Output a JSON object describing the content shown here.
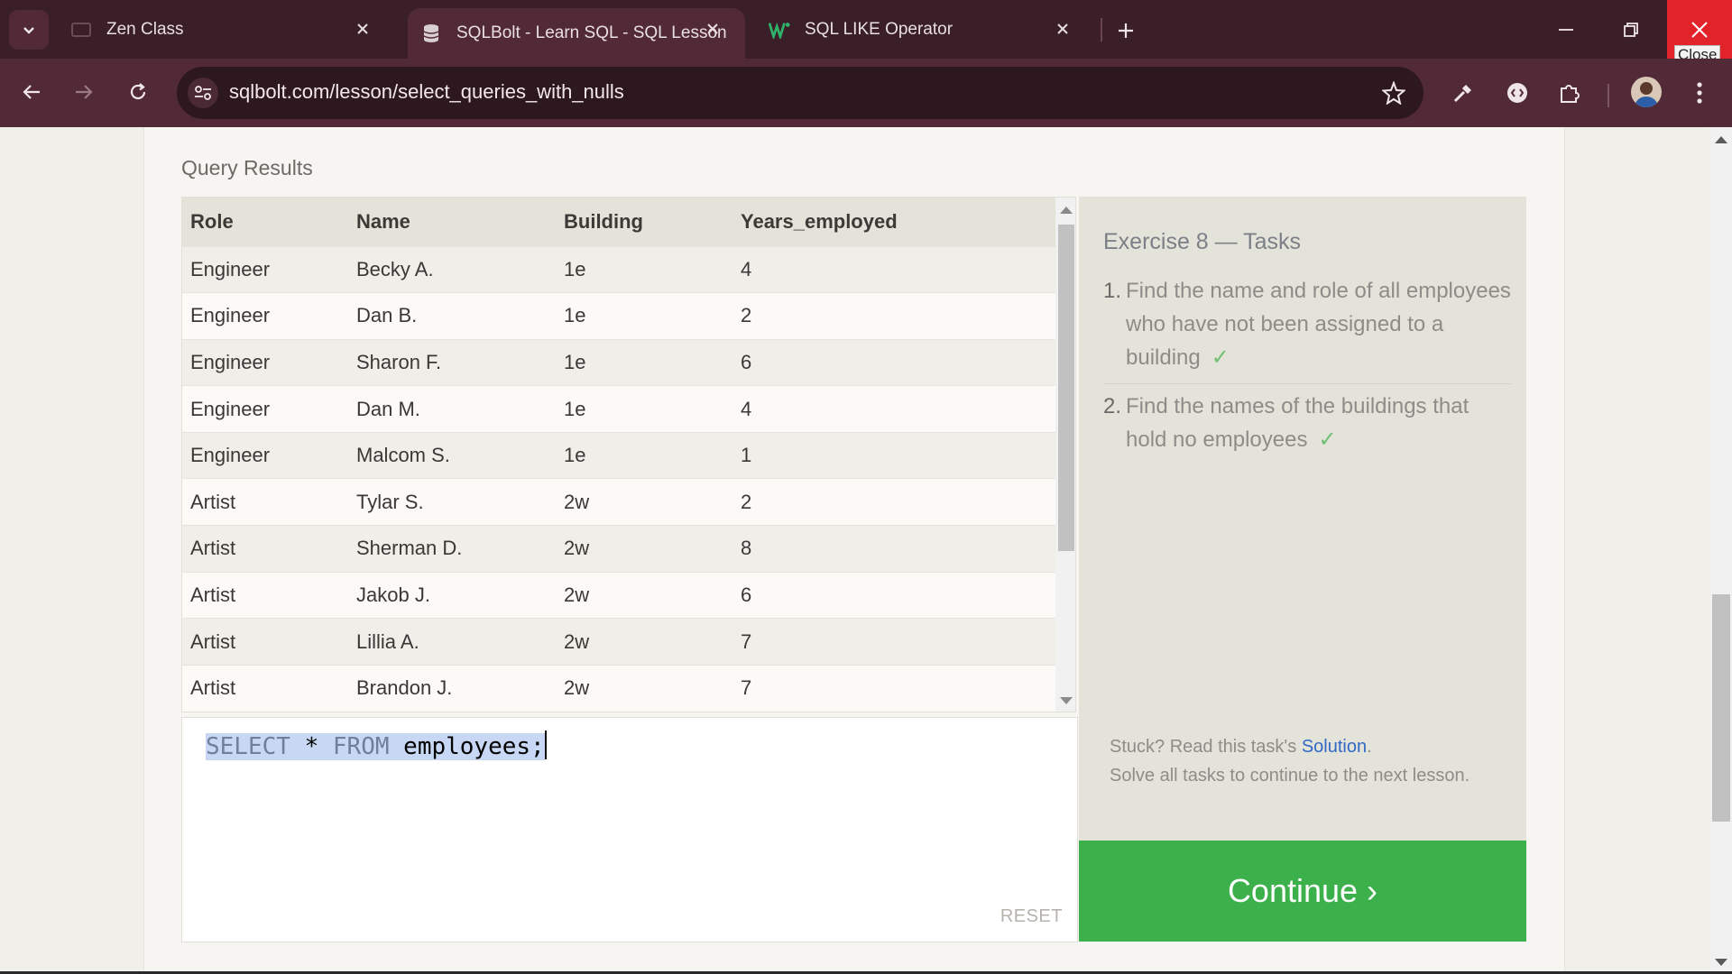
{
  "browser": {
    "tabs": [
      {
        "title": "Zen Class",
        "active": false
      },
      {
        "title": "SQLBolt - Learn SQL - SQL Lesson",
        "active": true
      },
      {
        "title": "SQL LIKE Operator",
        "active": false
      }
    ],
    "url": "sqlbolt.com/lesson/select_queries_with_nulls",
    "close_tooltip": "Close",
    "icons": [
      "tab-list-icon",
      "new-tab-icon",
      "back-icon",
      "forward-icon",
      "reload-icon",
      "site-info-icon",
      "bookmark-star-icon",
      "eyedropper-icon",
      "extension-icon",
      "puzzle-icon",
      "kebab-menu-icon"
    ]
  },
  "results": {
    "title": "Query Results",
    "columns": [
      "Role",
      "Name",
      "Building",
      "Years_employed"
    ],
    "rows": [
      [
        "Engineer",
        "Becky A.",
        "1e",
        "4"
      ],
      [
        "Engineer",
        "Dan B.",
        "1e",
        "2"
      ],
      [
        "Engineer",
        "Sharon F.",
        "1e",
        "6"
      ],
      [
        "Engineer",
        "Dan M.",
        "1e",
        "4"
      ],
      [
        "Engineer",
        "Malcom S.",
        "1e",
        "1"
      ],
      [
        "Artist",
        "Tylar S.",
        "2w",
        "2"
      ],
      [
        "Artist",
        "Sherman D.",
        "2w",
        "8"
      ],
      [
        "Artist",
        "Jakob J.",
        "2w",
        "6"
      ],
      [
        "Artist",
        "Lillia A.",
        "2w",
        "7"
      ],
      [
        "Artist",
        "Brandon J.",
        "2w",
        "7"
      ]
    ]
  },
  "editor": {
    "kw_select": "SELECT",
    "star": " * ",
    "kw_from": "FROM",
    "rest": " employees;",
    "reset_label": "RESET"
  },
  "tasks": {
    "title": "Exercise 8 — Tasks",
    "items": [
      {
        "num": "1.",
        "text": "Find the name and role of all employees who have not been assigned to a building",
        "check": "✓"
      },
      {
        "num": "2.",
        "text": "Find the names of the buildings that hold no employees",
        "check": "✓"
      }
    ],
    "help_prefix": "Stuck? Read this task's ",
    "help_link": "Solution",
    "help_suffix": ".",
    "help_line2": "Solve all tasks to continue to the next lesson."
  },
  "continue_label": "Continue ›",
  "colors": {
    "accent_green": "#3bb04b",
    "link_blue": "#3069c6",
    "chrome_bg": "#3a1e28",
    "close_red": "#e3232a"
  }
}
